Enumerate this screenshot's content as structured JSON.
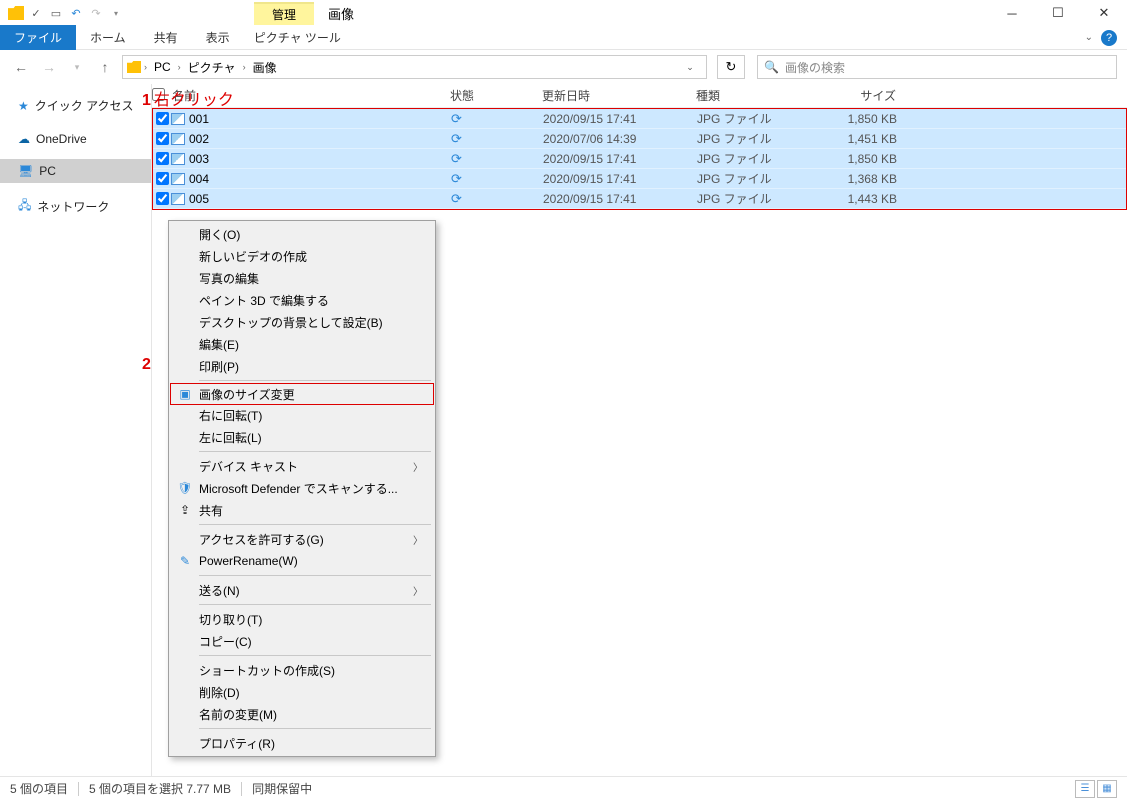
{
  "titlebar": {
    "manage_tab": "管理",
    "context_label": "画像"
  },
  "ribbon": {
    "file": "ファイル",
    "home": "ホーム",
    "share": "共有",
    "view": "表示",
    "picture_tools": "ピクチャ ツール"
  },
  "breadcrumb": {
    "pc": "PC",
    "pictures": "ピクチャ",
    "folder": "画像"
  },
  "search_placeholder": "画像の検索",
  "sidebar": {
    "quick": "クイック アクセス",
    "onedrive": "OneDrive",
    "pc": "PC",
    "network": "ネットワーク"
  },
  "columns": {
    "name": "名前",
    "state": "状態",
    "date": "更新日時",
    "type": "種類",
    "size": "サイズ"
  },
  "files": [
    {
      "name": "001",
      "date": "2020/09/15 17:41",
      "type": "JPG ファイル",
      "size": "1,850 KB"
    },
    {
      "name": "002",
      "date": "2020/07/06 14:39",
      "type": "JPG ファイル",
      "size": "1,451 KB"
    },
    {
      "name": "003",
      "date": "2020/09/15 17:41",
      "type": "JPG ファイル",
      "size": "1,850 KB"
    },
    {
      "name": "004",
      "date": "2020/09/15 17:41",
      "type": "JPG ファイル",
      "size": "1,368 KB"
    },
    {
      "name": "005",
      "date": "2020/09/15 17:41",
      "type": "JPG ファイル",
      "size": "1,443 KB"
    }
  ],
  "annot1_num": "1",
  "annot1_text": "右クリック",
  "annot2_num": "2",
  "context_menu": {
    "open": "開く(O)",
    "new_video": "新しいビデオの作成",
    "edit_photo": "写真の編集",
    "paint3d": "ペイント 3D で編集する",
    "set_wallpaper": "デスクトップの背景として設定(B)",
    "edit": "編集(E)",
    "print": "印刷(P)",
    "resize_image": "画像のサイズ変更",
    "rotate_right": "右に回転(T)",
    "rotate_left": "左に回転(L)",
    "device_cast": "デバイス キャスト",
    "defender": "Microsoft Defender でスキャンする...",
    "share": "共有",
    "give_access": "アクセスを許可する(G)",
    "powerrename": "PowerRename(W)",
    "send_to": "送る(N)",
    "cut": "切り取り(T)",
    "copy": "コピー(C)",
    "shortcut": "ショートカットの作成(S)",
    "delete": "削除(D)",
    "rename": "名前の変更(M)",
    "properties": "プロパティ(R)"
  },
  "status": {
    "count": "5 個の項目",
    "selection": "5 個の項目を選択 7.77 MB",
    "sync": "同期保留中"
  }
}
